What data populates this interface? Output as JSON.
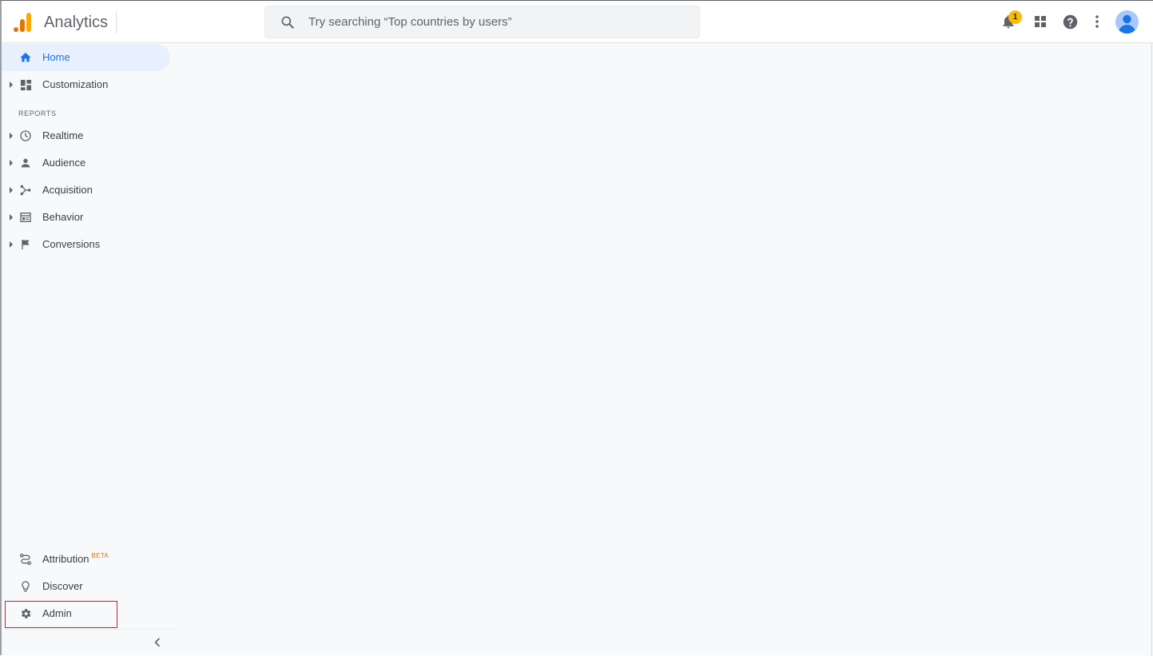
{
  "app": {
    "title": "Analytics",
    "logo_icon": "analytics-logo-icon",
    "brand_colors": [
      "#f9ab00",
      "#e37400"
    ]
  },
  "search": {
    "placeholder": "Try searching “Top countries by users”",
    "icon": "search-icon"
  },
  "header_actions": {
    "notifications": {
      "icon": "bell-icon",
      "count": "1"
    },
    "apps_icon": "apps-grid-icon",
    "help_icon": "help-icon",
    "more_icon": "more-vert-icon",
    "avatar_icon": "account-avatar-icon"
  },
  "sidebar": {
    "top_items": [
      {
        "label": "Home",
        "icon": "home-icon",
        "active": true
      },
      {
        "label": "Customization",
        "icon": "dashboard-icon",
        "expandable": true
      }
    ],
    "reports_section_label": "REPORTS",
    "report_items": [
      {
        "label": "Realtime",
        "icon": "clock-icon"
      },
      {
        "label": "Audience",
        "icon": "person-icon"
      },
      {
        "label": "Acquisition",
        "icon": "acquisition-icon"
      },
      {
        "label": "Behavior",
        "icon": "behavior-icon"
      },
      {
        "label": "Conversions",
        "icon": "flag-icon"
      }
    ],
    "bottom_items": [
      {
        "label": "Attribution",
        "badge": "BETA",
        "icon": "attribution-icon"
      },
      {
        "label": "Discover",
        "icon": "lightbulb-icon"
      },
      {
        "label": "Admin",
        "icon": "gear-icon",
        "highlighted": true
      }
    ],
    "collapse_icon": "chevron-left-icon"
  },
  "colors": {
    "accent": "#1a73e8",
    "active_bg": "#e8f0fe",
    "highlight_border": "#c5221f",
    "badge": "#fbbc04"
  }
}
